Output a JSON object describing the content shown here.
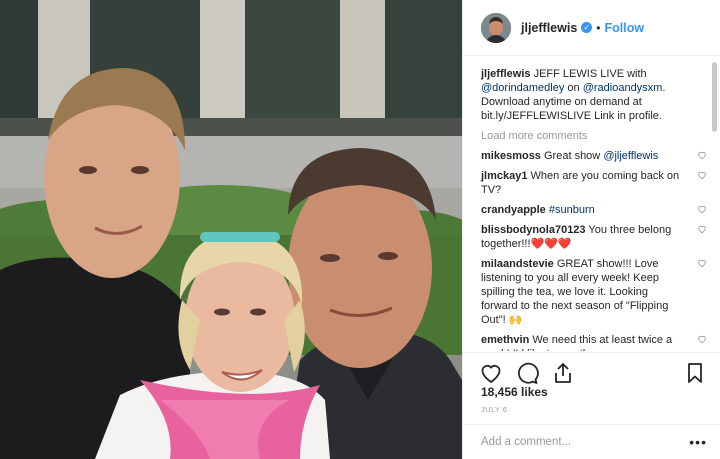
{
  "post": {
    "photo_alt": "Selfie of three people in front of a building",
    "author": {
      "username": "jljefflewis",
      "verified_icon": "verified-badge-icon",
      "separator": "•",
      "follow_label": "Follow"
    },
    "caption": {
      "username": "jljefflewis",
      "text_1": "JEFF LEWIS LIVE with",
      "mention_1": "@dorindamedley",
      "text_2": "on",
      "mention_2": "@radioandysxm",
      "text_3": ". Download anytime on demand at bit.ly/JEFFLEWISLIVE Link in profile."
    },
    "load_more": "Load more comments",
    "comments": [
      {
        "user": "mikesmoss",
        "text": "Great show",
        "mention": "@jljefflewis"
      },
      {
        "user": "jlmckay1",
        "text": "When are you coming back on TV?"
      },
      {
        "user": "crandyapple",
        "text": "",
        "mention": "#sunburn"
      },
      {
        "user": "blissbodynola70123",
        "text": "You three belong together!!!❤️❤️❤️"
      },
      {
        "user": "milaandstevie",
        "text": "GREAT show!!! Love listening to you all every week! Keep spilling the tea, we love it. Looking forward to the next season of \"Flipping Out\"! 🙌"
      },
      {
        "user": "emethvin",
        "text": "We need this at least twice a week! I'd like to see them"
      }
    ],
    "actions": {
      "like_icon": "heart-icon",
      "comment_icon": "comment-icon",
      "share_icon": "share-icon",
      "save_icon": "bookmark-icon"
    },
    "likes": "18,456 likes",
    "date": "JULY 6",
    "add_comment_placeholder": "Add a comment...",
    "more_label": "•••"
  },
  "colors": {
    "link": "#3897f0",
    "mention": "#003569",
    "muted": "#999999",
    "text": "#262626"
  }
}
